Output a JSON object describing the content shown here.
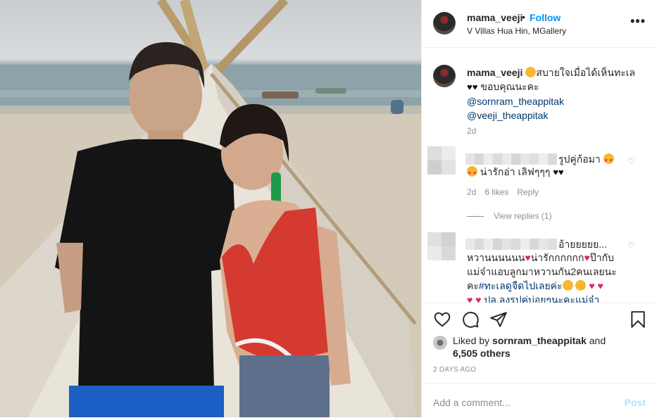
{
  "post": {
    "username": "mama_veeji",
    "follow_label": "Follow",
    "separator": "•",
    "location": "V Villas Hua Hin, MGallery",
    "more_icon": "more-horizontal-icon",
    "more_label": "•••"
  },
  "caption": {
    "username": "mama_veeji",
    "text_line1": "สบายใจเมื่อได้เห็นทะเล",
    "text_line2": "ขอบคุณนะคะ",
    "mentions": [
      "@sornram_theappitak",
      "@veeji_theappitak"
    ],
    "time": "2d"
  },
  "comments": [
    {
      "text_line1": "รูปคู่ก้อมา",
      "text_line2": "น่ารักอ่า เลิฟๆๆๆ",
      "time": "2d",
      "likes": "6 likes",
      "reply": "Reply",
      "view_replies": "View replies (1)"
    },
    {
      "text_line1": "อ้ายยยยย...",
      "text_line2": "หวานนนนนน",
      "text_line2b": "น่ารักกกกกก",
      "text_line2c": "ป๊ากับ",
      "text_line3": "แม่จ๋าแอบลูกมาหวานกัน2คนเลยนะ",
      "text_line4_plain": "คะ",
      "text_line4_tag": "#ทะเลดูจืดไปเลยค่ะ",
      "text_line5_tag": "ปล.ลงรูปคู่บ่อยๆนะคะแม่จ๋า"
    }
  ],
  "likes": {
    "prefix": "Liked by",
    "user": "sornram_theappitak",
    "and": "and",
    "count": "6,505 others"
  },
  "timestamp": "2 DAYS AGO",
  "add_comment": {
    "placeholder": "Add a comment...",
    "post_label": "Post"
  },
  "icons": {
    "like": "heart-icon",
    "comment": "comment-icon",
    "share": "share-icon",
    "save": "bookmark-icon"
  },
  "colors": {
    "link_blue": "#0095f6",
    "mention": "#00376b",
    "muted": "#8e8e8e",
    "post_disabled": "#b2dffc"
  }
}
